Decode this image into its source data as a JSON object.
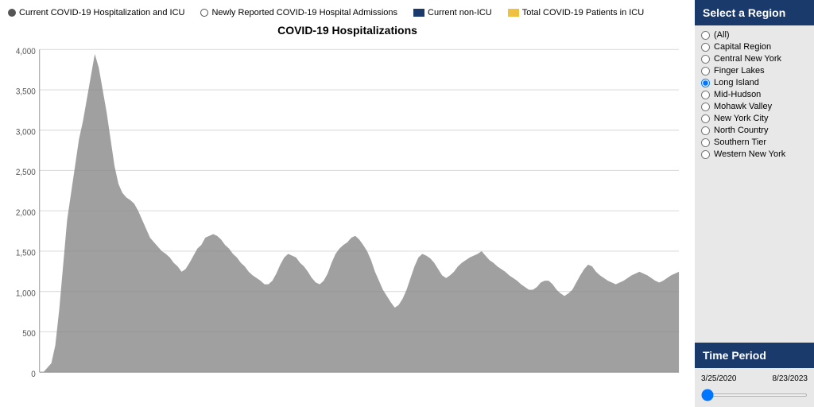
{
  "legend": {
    "items": [
      {
        "id": "current-hosp-icu",
        "label": "Current COVID-19 Hospitalization and ICU",
        "type": "circle-filled"
      },
      {
        "id": "newly-reported",
        "label": "Newly Reported COVID-19 Hospital Admissions",
        "type": "circle-empty"
      },
      {
        "id": "current-non-icu",
        "label": "Current non-ICU",
        "type": "box-dark-blue"
      },
      {
        "id": "total-icu",
        "label": "Total COVID-19 Patients in ICU",
        "type": "box-yellow"
      }
    ]
  },
  "chart": {
    "title": "COVID-19 Hospitalizations",
    "y_axis_labels": [
      "4,000",
      "3,500",
      "3,000",
      "2,500",
      "2,000",
      "1,500",
      "1,000",
      "500",
      "0"
    ]
  },
  "sidebar": {
    "select_region_header": "Select a Region",
    "regions": [
      {
        "id": "all",
        "label": "(All)",
        "selected": false
      },
      {
        "id": "capital-region",
        "label": "Capital Region",
        "selected": false
      },
      {
        "id": "central-new-york",
        "label": "Central New York",
        "selected": false
      },
      {
        "id": "finger-lakes",
        "label": "Finger Lakes",
        "selected": false
      },
      {
        "id": "long-island",
        "label": "Long Island",
        "selected": true
      },
      {
        "id": "mid-hudson",
        "label": "Mid-Hudson",
        "selected": false
      },
      {
        "id": "mohawk-valley",
        "label": "Mohawk Valley",
        "selected": false
      },
      {
        "id": "new-york-city",
        "label": "New York City",
        "selected": false
      },
      {
        "id": "north-country",
        "label": "North Country",
        "selected": false
      },
      {
        "id": "southern-tier",
        "label": "Southern Tier",
        "selected": false
      },
      {
        "id": "western-new-york",
        "label": "Western New York",
        "selected": false
      }
    ],
    "time_period_header": "Time Period",
    "time_period": {
      "start": "3/25/2020",
      "end": "8/23/2023",
      "slider_min": 0,
      "slider_max": 100,
      "slider_value": 0
    }
  }
}
